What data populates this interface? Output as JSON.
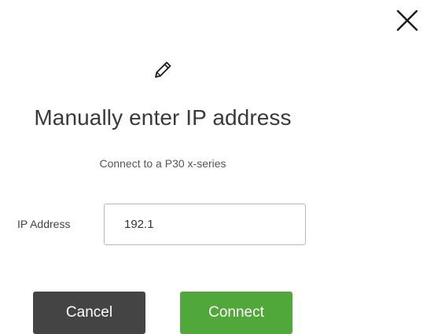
{
  "dialog": {
    "close_icon": "close-icon",
    "header_icon": "pencil-icon",
    "title": "Manually enter IP address",
    "subtitle": "Connect to a P30 x-series",
    "ip_field": {
      "label": "IP Address",
      "value": "192.1",
      "placeholder": ""
    },
    "buttons": {
      "cancel_label": "Cancel",
      "connect_label": "Connect"
    }
  },
  "colors": {
    "connect_button": "#51a83a",
    "cancel_button": "#444444",
    "input_border": "#b8b8b8",
    "text": "#333333"
  }
}
